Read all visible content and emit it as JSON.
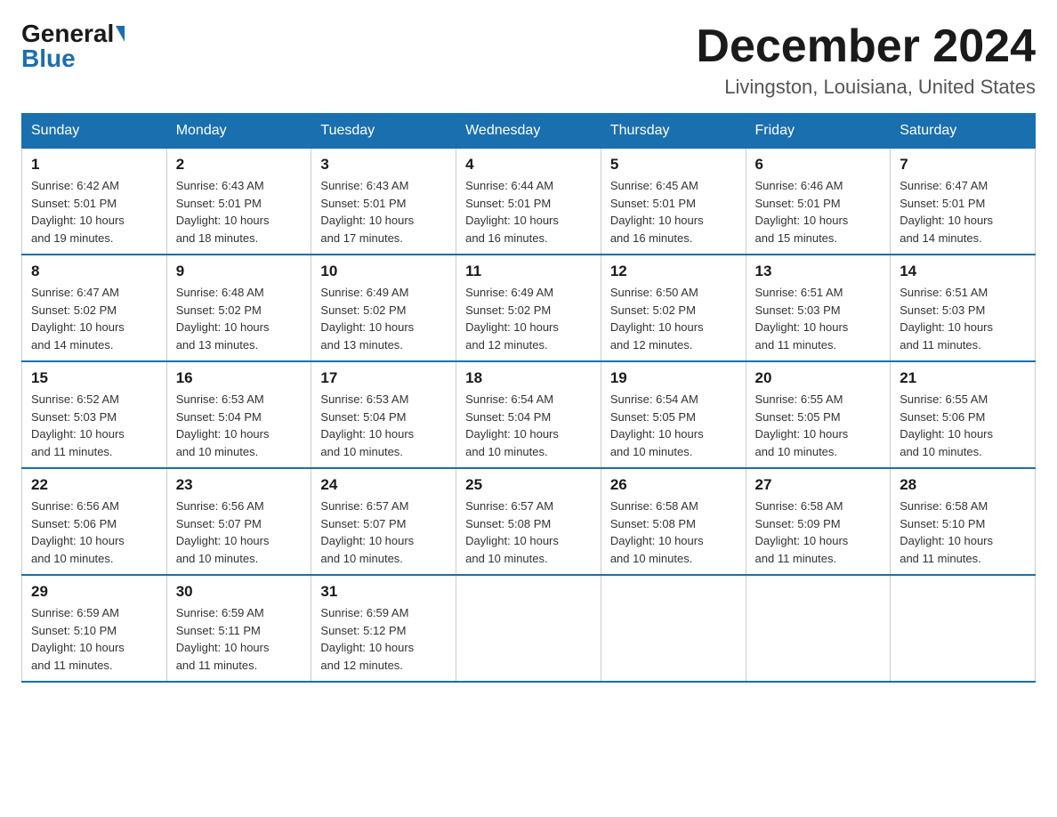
{
  "header": {
    "logo_general": "General",
    "logo_blue": "Blue",
    "month_title": "December 2024",
    "location": "Livingston, Louisiana, United States"
  },
  "days_of_week": [
    "Sunday",
    "Monday",
    "Tuesday",
    "Wednesday",
    "Thursday",
    "Friday",
    "Saturday"
  ],
  "weeks": [
    [
      {
        "day": "1",
        "sunrise": "6:42 AM",
        "sunset": "5:01 PM",
        "daylight": "10 hours and 19 minutes."
      },
      {
        "day": "2",
        "sunrise": "6:43 AM",
        "sunset": "5:01 PM",
        "daylight": "10 hours and 18 minutes."
      },
      {
        "day": "3",
        "sunrise": "6:43 AM",
        "sunset": "5:01 PM",
        "daylight": "10 hours and 17 minutes."
      },
      {
        "day": "4",
        "sunrise": "6:44 AM",
        "sunset": "5:01 PM",
        "daylight": "10 hours and 16 minutes."
      },
      {
        "day": "5",
        "sunrise": "6:45 AM",
        "sunset": "5:01 PM",
        "daylight": "10 hours and 16 minutes."
      },
      {
        "day": "6",
        "sunrise": "6:46 AM",
        "sunset": "5:01 PM",
        "daylight": "10 hours and 15 minutes."
      },
      {
        "day": "7",
        "sunrise": "6:47 AM",
        "sunset": "5:01 PM",
        "daylight": "10 hours and 14 minutes."
      }
    ],
    [
      {
        "day": "8",
        "sunrise": "6:47 AM",
        "sunset": "5:02 PM",
        "daylight": "10 hours and 14 minutes."
      },
      {
        "day": "9",
        "sunrise": "6:48 AM",
        "sunset": "5:02 PM",
        "daylight": "10 hours and 13 minutes."
      },
      {
        "day": "10",
        "sunrise": "6:49 AM",
        "sunset": "5:02 PM",
        "daylight": "10 hours and 13 minutes."
      },
      {
        "day": "11",
        "sunrise": "6:49 AM",
        "sunset": "5:02 PM",
        "daylight": "10 hours and 12 minutes."
      },
      {
        "day": "12",
        "sunrise": "6:50 AM",
        "sunset": "5:02 PM",
        "daylight": "10 hours and 12 minutes."
      },
      {
        "day": "13",
        "sunrise": "6:51 AM",
        "sunset": "5:03 PM",
        "daylight": "10 hours and 11 minutes."
      },
      {
        "day": "14",
        "sunrise": "6:51 AM",
        "sunset": "5:03 PM",
        "daylight": "10 hours and 11 minutes."
      }
    ],
    [
      {
        "day": "15",
        "sunrise": "6:52 AM",
        "sunset": "5:03 PM",
        "daylight": "10 hours and 11 minutes."
      },
      {
        "day": "16",
        "sunrise": "6:53 AM",
        "sunset": "5:04 PM",
        "daylight": "10 hours and 10 minutes."
      },
      {
        "day": "17",
        "sunrise": "6:53 AM",
        "sunset": "5:04 PM",
        "daylight": "10 hours and 10 minutes."
      },
      {
        "day": "18",
        "sunrise": "6:54 AM",
        "sunset": "5:04 PM",
        "daylight": "10 hours and 10 minutes."
      },
      {
        "day": "19",
        "sunrise": "6:54 AM",
        "sunset": "5:05 PM",
        "daylight": "10 hours and 10 minutes."
      },
      {
        "day": "20",
        "sunrise": "6:55 AM",
        "sunset": "5:05 PM",
        "daylight": "10 hours and 10 minutes."
      },
      {
        "day": "21",
        "sunrise": "6:55 AM",
        "sunset": "5:06 PM",
        "daylight": "10 hours and 10 minutes."
      }
    ],
    [
      {
        "day": "22",
        "sunrise": "6:56 AM",
        "sunset": "5:06 PM",
        "daylight": "10 hours and 10 minutes."
      },
      {
        "day": "23",
        "sunrise": "6:56 AM",
        "sunset": "5:07 PM",
        "daylight": "10 hours and 10 minutes."
      },
      {
        "day": "24",
        "sunrise": "6:57 AM",
        "sunset": "5:07 PM",
        "daylight": "10 hours and 10 minutes."
      },
      {
        "day": "25",
        "sunrise": "6:57 AM",
        "sunset": "5:08 PM",
        "daylight": "10 hours and 10 minutes."
      },
      {
        "day": "26",
        "sunrise": "6:58 AM",
        "sunset": "5:08 PM",
        "daylight": "10 hours and 10 minutes."
      },
      {
        "day": "27",
        "sunrise": "6:58 AM",
        "sunset": "5:09 PM",
        "daylight": "10 hours and 11 minutes."
      },
      {
        "day": "28",
        "sunrise": "6:58 AM",
        "sunset": "5:10 PM",
        "daylight": "10 hours and 11 minutes."
      }
    ],
    [
      {
        "day": "29",
        "sunrise": "6:59 AM",
        "sunset": "5:10 PM",
        "daylight": "10 hours and 11 minutes."
      },
      {
        "day": "30",
        "sunrise": "6:59 AM",
        "sunset": "5:11 PM",
        "daylight": "10 hours and 11 minutes."
      },
      {
        "day": "31",
        "sunrise": "6:59 AM",
        "sunset": "5:12 PM",
        "daylight": "10 hours and 12 minutes."
      },
      null,
      null,
      null,
      null
    ]
  ],
  "labels": {
    "sunrise": "Sunrise:",
    "sunset": "Sunset:",
    "daylight": "Daylight:"
  }
}
